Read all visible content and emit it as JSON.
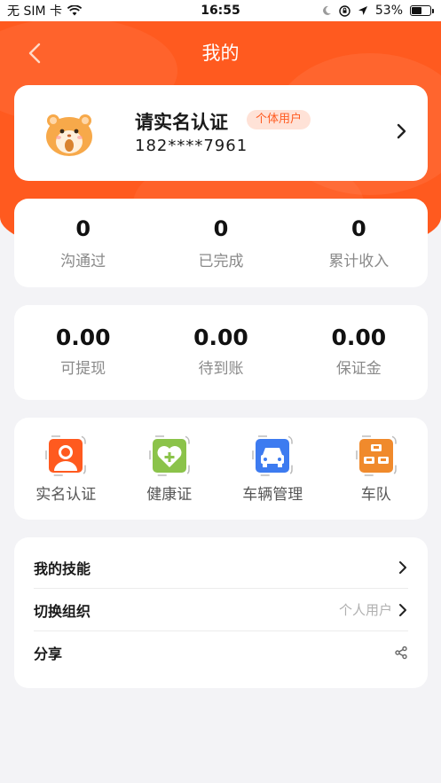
{
  "status_bar": {
    "carrier": "无 SIM 卡",
    "time": "16:55",
    "battery_percent": "53%",
    "battery_level": 0.53
  },
  "nav": {
    "title": "我的"
  },
  "profile": {
    "name": "请实名认证",
    "badge": "个体用户",
    "phone": "182****7961"
  },
  "stats_top": [
    {
      "value": "0",
      "label": "沟通过"
    },
    {
      "value": "0",
      "label": "已完成"
    },
    {
      "value": "0",
      "label": "累计收入"
    }
  ],
  "stats_money": [
    {
      "value": "0.00",
      "label": "可提现"
    },
    {
      "value": "0.00",
      "label": "待到账"
    },
    {
      "value": "0.00",
      "label": "保证金"
    }
  ],
  "services": [
    {
      "label": "实名认证",
      "icon": "id-person-icon",
      "color": "#ff5a1f"
    },
    {
      "label": "健康证",
      "icon": "health-heart-icon",
      "color": "#8bc34a"
    },
    {
      "label": "车辆管理",
      "icon": "car-icon",
      "color": "#3d7bf0"
    },
    {
      "label": "车队",
      "icon": "fleet-icon",
      "color": "#f08a2c"
    }
  ],
  "menu": [
    {
      "label": "我的技能",
      "value": ""
    },
    {
      "label": "切换组织",
      "value": "个人用户"
    },
    {
      "label": "分享",
      "value": ""
    }
  ],
  "colors": {
    "brand": "#ff5a1f",
    "background": "#f3f3f6"
  }
}
